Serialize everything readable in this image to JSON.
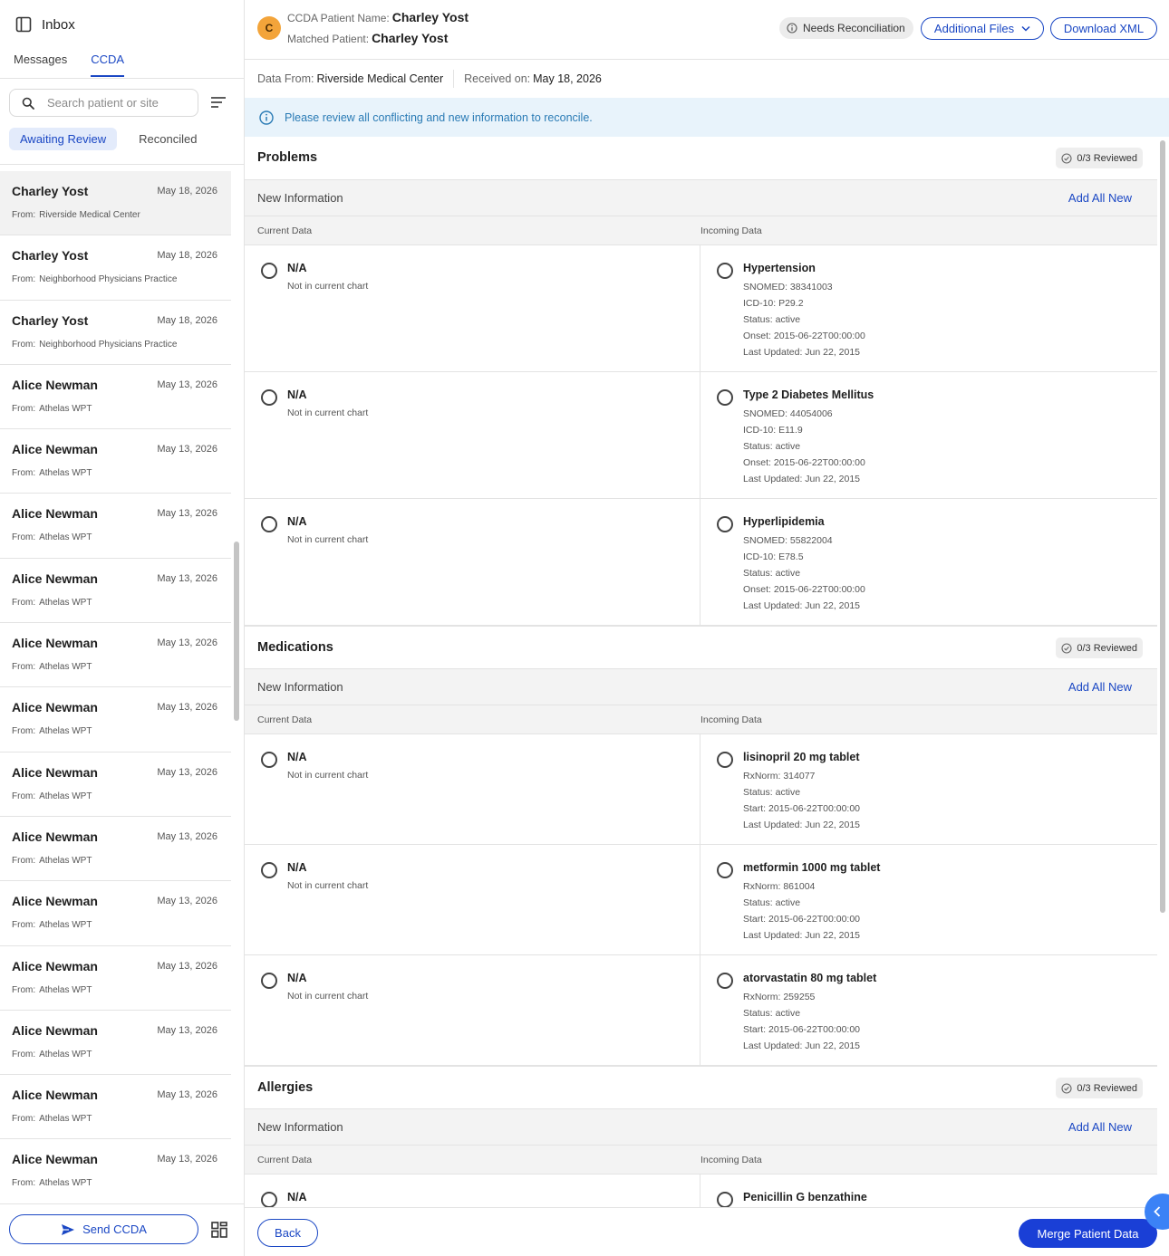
{
  "sidebar": {
    "title": "Inbox",
    "tabs": [
      {
        "label": "Messages",
        "active": false
      },
      {
        "label": "CCDA",
        "active": true
      }
    ],
    "search_placeholder": "Search patient or site",
    "filters": [
      {
        "label": "Awaiting Review",
        "active": true
      },
      {
        "label": "Reconciled",
        "active": false
      }
    ],
    "from_label": "From:",
    "items": [
      {
        "name": "Charley Yost",
        "date": "May 18, 2026",
        "from": "Riverside Medical Center",
        "selected": true
      },
      {
        "name": "Charley Yost",
        "date": "May 18, 2026",
        "from": "Neighborhood Physicians Practice"
      },
      {
        "name": "Charley Yost",
        "date": "May 18, 2026",
        "from": "Neighborhood Physicians Practice"
      },
      {
        "name": "Alice Newman",
        "date": "May 13, 2026",
        "from": "Athelas WPT"
      },
      {
        "name": "Alice Newman",
        "date": "May 13, 2026",
        "from": "Athelas WPT"
      },
      {
        "name": "Alice Newman",
        "date": "May 13, 2026",
        "from": "Athelas WPT"
      },
      {
        "name": "Alice Newman",
        "date": "May 13, 2026",
        "from": "Athelas WPT"
      },
      {
        "name": "Alice Newman",
        "date": "May 13, 2026",
        "from": "Athelas WPT"
      },
      {
        "name": "Alice Newman",
        "date": "May 13, 2026",
        "from": "Athelas WPT"
      },
      {
        "name": "Alice Newman",
        "date": "May 13, 2026",
        "from": "Athelas WPT"
      },
      {
        "name": "Alice Newman",
        "date": "May 13, 2026",
        "from": "Athelas WPT"
      },
      {
        "name": "Alice Newman",
        "date": "May 13, 2026",
        "from": "Athelas WPT"
      },
      {
        "name": "Alice Newman",
        "date": "May 13, 2026",
        "from": "Athelas WPT"
      },
      {
        "name": "Alice Newman",
        "date": "May 13, 2026",
        "from": "Athelas WPT"
      },
      {
        "name": "Alice Newman",
        "date": "May 13, 2026",
        "from": "Athelas WPT"
      },
      {
        "name": "Alice Newman",
        "date": "May 13, 2026",
        "from": "Athelas WPT"
      }
    ],
    "send_button": "Send CCDA"
  },
  "header": {
    "avatar_initial": "C",
    "ccda_label": "CCDA Patient Name:",
    "ccda_name": "Charley Yost",
    "matched_label": "Matched Patient:",
    "matched_name": "Charley Yost",
    "status_badge": "Needs Reconciliation",
    "additional_files": "Additional Files",
    "download_xml": "Download XML"
  },
  "meta": {
    "data_from_label": "Data From:",
    "data_from": "Riverside Medical Center",
    "received_label": "Received on:",
    "received": "May 18, 2026"
  },
  "banner": "Please review all conflicting and new information to reconcile.",
  "common": {
    "new_information": "New Information",
    "add_all_new": "Add All New",
    "current_data": "Current Data",
    "incoming_data": "Incoming Data",
    "na": "N/A",
    "not_in_chart": "Not in current chart"
  },
  "sections": [
    {
      "title": "Problems",
      "reviewed": "0/3 Reviewed",
      "rows": [
        {
          "title": "Hypertension",
          "lines": [
            "SNOMED: 38341003",
            "ICD-10: P29.2",
            "Status: active",
            "Onset: 2015-06-22T00:00:00",
            "Last Updated: Jun 22, 2015"
          ]
        },
        {
          "title": "Type 2 Diabetes Mellitus",
          "lines": [
            "SNOMED: 44054006",
            "ICD-10: E11.9",
            "Status: active",
            "Onset: 2015-06-22T00:00:00",
            "Last Updated: Jun 22, 2015"
          ]
        },
        {
          "title": "Hyperlipidemia",
          "lines": [
            "SNOMED: 55822004",
            "ICD-10: E78.5",
            "Status: active",
            "Onset: 2015-06-22T00:00:00",
            "Last Updated: Jun 22, 2015"
          ]
        }
      ]
    },
    {
      "title": "Medications",
      "reviewed": "0/3 Reviewed",
      "rows": [
        {
          "title": "lisinopril 20 mg tablet",
          "lines": [
            "RxNorm: 314077",
            "Status: active",
            "Start: 2015-06-22T00:00:00",
            "Last Updated: Jun 22, 2015"
          ]
        },
        {
          "title": "metformin 1000 mg tablet",
          "lines": [
            "RxNorm: 861004",
            "Status: active",
            "Start: 2015-06-22T00:00:00",
            "Last Updated: Jun 22, 2015"
          ]
        },
        {
          "title": "atorvastatin 80 mg tablet",
          "lines": [
            "RxNorm: 259255",
            "Status: active",
            "Start: 2015-06-22T00:00:00",
            "Last Updated: Jun 22, 2015"
          ]
        }
      ]
    },
    {
      "title": "Allergies",
      "reviewed": "0/3 Reviewed",
      "rows": [
        {
          "title": "Penicillin G benzathine",
          "lines": []
        }
      ]
    }
  ],
  "footer": {
    "back": "Back",
    "merge": "Merge Patient Data"
  },
  "colors": {
    "primary": "#1a47c4",
    "merge_button": "#1a3fd6",
    "avatar": "#f3a43a",
    "banner_bg": "#e8f3fb",
    "banner_text": "#2a7bb5"
  },
  "icons": {
    "sidebar_toggle": "sidebar-panel-icon",
    "search": "search-icon",
    "filter": "filter-lines-icon",
    "send": "paper-plane-icon",
    "grid": "grid-icon",
    "info": "info-circle-icon",
    "check": "check-circle-icon",
    "chevron": "chevron-down-icon",
    "collapse": "chevron-left-icon"
  }
}
